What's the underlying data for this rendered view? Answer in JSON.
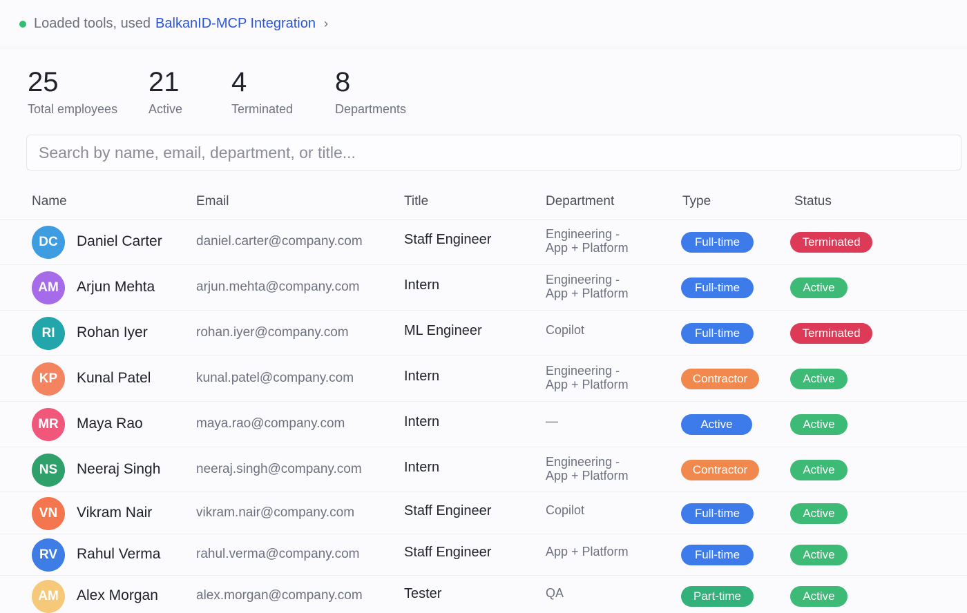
{
  "toolbar": {
    "prefix": "Loaded tools, used",
    "link": "BalkanID-MCP Integration",
    "chevron": "›"
  },
  "stats": [
    {
      "value": "25",
      "label": "Total employees"
    },
    {
      "value": "21",
      "label": "Active"
    },
    {
      "value": "4",
      "label": "Terminated"
    },
    {
      "value": "8",
      "label": "Departments"
    }
  ],
  "search": {
    "placeholder": "Search by name, email, department, or title..."
  },
  "columns": {
    "name": "Name",
    "email": "Email",
    "title": "Title",
    "department": "Department",
    "type": "Type",
    "status": "Status"
  },
  "rows": [
    {
      "initials": "DC",
      "avatar_color": "#3d9de0",
      "name": "Daniel Carter",
      "email": "daniel.carter@company.com",
      "title": "Staff Engineer",
      "department": [
        "Engineering -",
        "App + Platform"
      ],
      "type": "Full-time",
      "type_color": "#3d7bea",
      "status": "Terminated",
      "status_color": "#dc3a56"
    },
    {
      "initials": "AM",
      "avatar_color": "#a66be8",
      "name": "Arjun Mehta",
      "email": "arjun.mehta@company.com",
      "title": "Intern",
      "department": [
        "Engineering -",
        "App + Platform"
      ],
      "type": "Full-time",
      "type_color": "#3d7bea",
      "status": "Active",
      "status_color": "#3dba75"
    },
    {
      "initials": "RI",
      "avatar_color": "#23a6ab",
      "name": "Rohan Iyer",
      "email": "rohan.iyer@company.com",
      "title": "ML Engineer",
      "department": [
        "Copilot"
      ],
      "type": "Full-time",
      "type_color": "#3d7bea",
      "status": "Terminated",
      "status_color": "#dc3a56"
    },
    {
      "initials": "KP",
      "avatar_color": "#f3845f",
      "name": "Kunal Patel",
      "email": "kunal.patel@company.com",
      "title": "Intern",
      "department": [
        "Engineering -",
        "App + Platform"
      ],
      "type": "Contractor",
      "type_color": "#f1894f",
      "status": "Active",
      "status_color": "#3dba75"
    },
    {
      "initials": "MR",
      "avatar_color": "#f0577a",
      "name": "Maya Rao",
      "email": "maya.rao@company.com",
      "title": "Intern",
      "department": [
        "—"
      ],
      "type": "Active",
      "type_color": "#3d7bea",
      "status": "Active",
      "status_color": "#3dba75"
    },
    {
      "initials": "NS",
      "avatar_color": "#2fa06a",
      "name": "Neeraj Singh",
      "email": "neeraj.singh@company.com",
      "title": "Intern",
      "department": [
        "Engineering -",
        "App + Platform"
      ],
      "type": "Contractor",
      "type_color": "#f1894f",
      "status": "Active",
      "status_color": "#3dba75"
    },
    {
      "initials": "VN",
      "avatar_color": "#f3764f",
      "name": "Vikram Nair",
      "email": "vikram.nair@company.com",
      "title": "Staff Engineer",
      "department": [
        "Copilot"
      ],
      "type": "Full-time",
      "type_color": "#3d7bea",
      "status": "Active",
      "status_color": "#3dba75"
    },
    {
      "initials": "RV",
      "avatar_color": "#3f7de6",
      "name": "Rahul Verma",
      "email": "rahul.verma@company.com",
      "title": "Staff Engineer",
      "department": [
        "App + Platform"
      ],
      "type": "Full-time",
      "type_color": "#3d7bea",
      "status": "Active",
      "status_color": "#3dba75"
    },
    {
      "initials": "AM",
      "avatar_color": "#f6c87a",
      "name": "Alex Morgan",
      "email": "alex.morgan@company.com",
      "title": "Tester",
      "department": [
        "QA"
      ],
      "type": "Part-time",
      "type_color": "#32b27a",
      "status": "Active",
      "status_color": "#3dba75"
    }
  ]
}
